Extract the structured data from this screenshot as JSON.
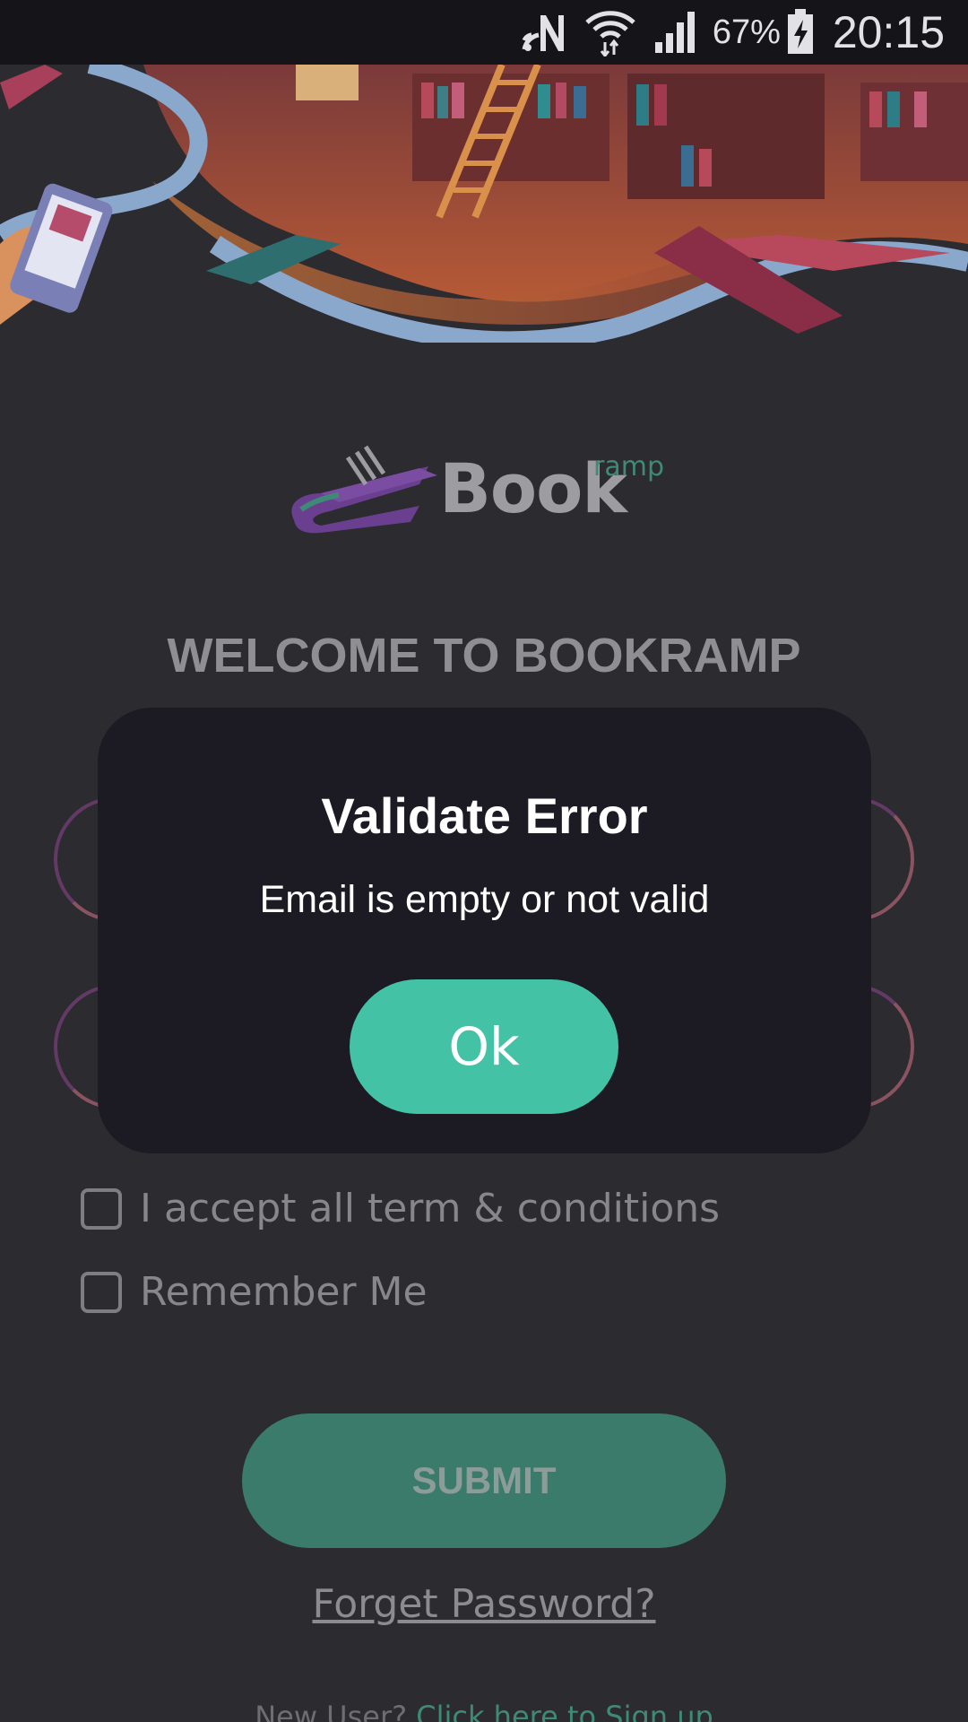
{
  "status_bar": {
    "icons": [
      "nfc-icon",
      "wifi-icon",
      "cell-signal-icon",
      "battery-charging-icon"
    ],
    "battery": "67%",
    "time": "20:15"
  },
  "logo": {
    "text": "Book",
    "superscript": "ramp"
  },
  "welcome": "WELCOME TO BOOKRAMP",
  "form": {
    "accept_terms_label": "I accept all term & conditions",
    "remember_label": "Remember Me",
    "submit_label": "SUBMIT",
    "forgot_label": "Forget Password?",
    "signup_prefix": "New User? ",
    "signup_link": "Click here to Sign up"
  },
  "dialog": {
    "title": "Validate Error",
    "message": "Email is empty or not valid",
    "ok_label": "Ok"
  },
  "colors": {
    "background": "#2c2b30",
    "accent": "#44c2a6",
    "dialog": "#1c1b24",
    "brand_purple": "#6a3f8f"
  }
}
